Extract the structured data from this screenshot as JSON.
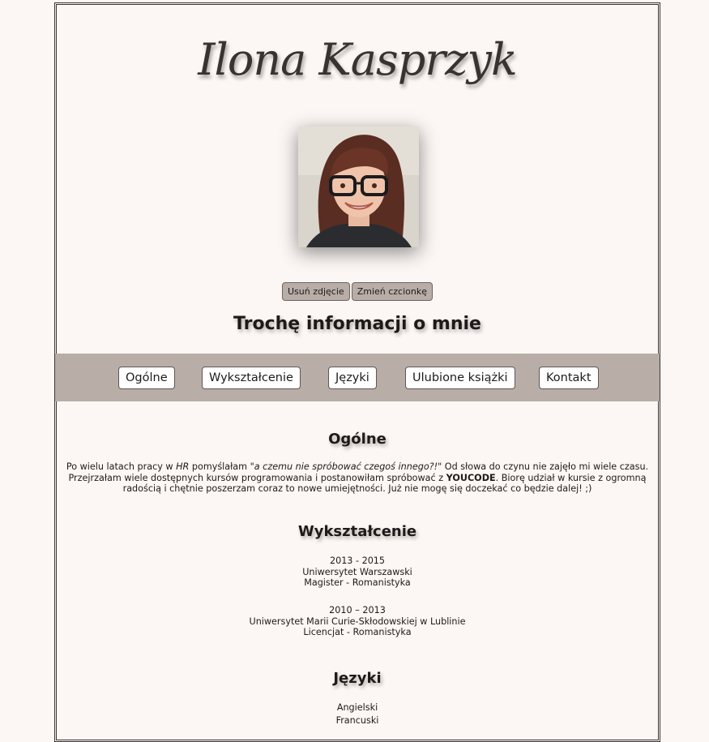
{
  "header": {
    "name": "Ilona Kasprzyk"
  },
  "photo": {
    "alt": "portrait-photo"
  },
  "buttons": {
    "remove_photo": "Usuń zdjęcie",
    "change_font": "Zmień czcionkę"
  },
  "about_title": "Trochę informacji o mnie",
  "nav": {
    "items": [
      "Ogólne",
      "Wykształcenie",
      "Języki",
      "Ulubione książki",
      "Kontakt"
    ]
  },
  "general": {
    "title": "Ogólne",
    "p1": "Po wielu latach pracy w ",
    "hr": "HR",
    "p2": " pomyślałam ",
    "quote": "\"a czemu nie spróbować czegoś innego?!\"",
    "p3": " Od słowa do czynu nie zajęło mi wiele czasu. Przejrzałam wiele dostępnych kursów programowania i postanowiłam spróbować z ",
    "brand": "YOUCODE",
    "p4": ". Biorę udział w kursie z ogromną radością i chętnie poszerzam coraz to nowe umiejętności. Już nie mogę się doczekać co będzie dalej! ;)"
  },
  "education": {
    "title": "Wykształcenie",
    "entries": [
      {
        "years": "2013 - 2015",
        "school": "Uniwersytet Warszawski",
        "degree": "Magister - Romanistyka"
      },
      {
        "years": "2010 – 2013",
        "school": "Uniwersytet Marii Curie-Skłodowskiej w Lublinie",
        "degree": "Licencjat - Romanistyka"
      }
    ]
  },
  "languages": {
    "title": "Języki",
    "items": [
      "Angielski",
      "Francuski"
    ]
  },
  "colors": {
    "background": "#fcf7f4",
    "nav_bar": "#b9ada7",
    "small_button": "#b9ada7",
    "text": "#1e1a1a"
  }
}
